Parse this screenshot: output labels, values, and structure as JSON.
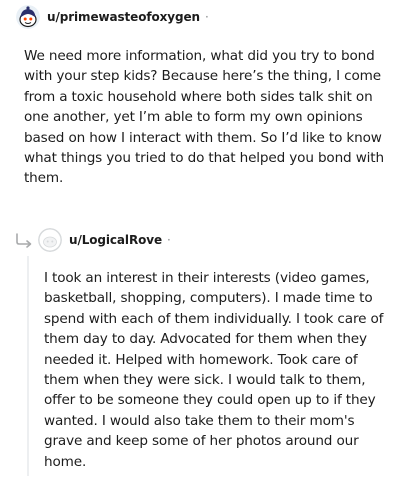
{
  "comments": [
    {
      "username": "u/primewasteofoxygen",
      "separator": "·",
      "avatar_icon": "snoo-avatar-icon",
      "body": "We need more information, what did you try to bond with your step kids? Because here’s the thing, I come from a toxic household where both sides talk shit on one another, yet I’m able to form my own opinions based on how I interact with them. So I’d like to know what things you tried to do that helped you bond with them."
    },
    {
      "username": "u/LogicalRove",
      "separator": "·",
      "avatar_icon": "default-avatar-icon",
      "reply_icon": "reply-arrow-icon",
      "body": "I took an interest in their interests (video games, basketball, shopping, computers). I made time to spend with each of them individually. I took care of them day to day. Advocated for them when they needed it. Helped with homework. Took care of them when they were sick. I would talk to them, offer to be someone they could open up to if they wanted. I would also take them to their mom's grave and keep some of her photos around our home."
    }
  ]
}
